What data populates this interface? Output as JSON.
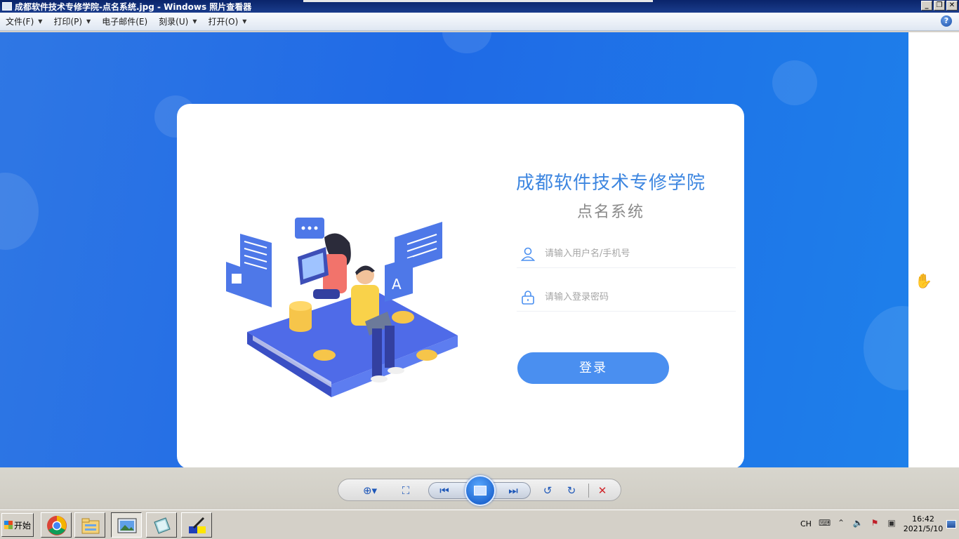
{
  "window": {
    "title": "成都软件技术专修学院-点名系统.jpg - Windows 照片查看器",
    "controls": [
      "_",
      "❐",
      "✕"
    ]
  },
  "menubar": {
    "items": [
      {
        "label": "文件(F)",
        "has_dropdown": true
      },
      {
        "label": "打印(P)",
        "has_dropdown": true
      },
      {
        "label": "电子邮件(E)",
        "has_dropdown": false
      },
      {
        "label": "刻录(U)",
        "has_dropdown": true
      },
      {
        "label": "打开(O)",
        "has_dropdown": true
      }
    ],
    "help": "?"
  },
  "photo": {
    "heading": "成都软件技术专修学院",
    "subheading": "点名系统",
    "username_placeholder": "请输入用户名/手机号",
    "password_placeholder": "请输入登录密码",
    "login_label": "登录",
    "colors": {
      "background": "#1f6ae6",
      "accent": "#4a8ff0",
      "heading": "#3d86e0"
    }
  },
  "viewer_controls": {
    "icons": [
      "zoom-icon",
      "actual-size-icon",
      "previous-icon",
      "slideshow-icon",
      "next-icon",
      "rotate-left-icon",
      "rotate-right-icon",
      "delete-icon"
    ]
  },
  "taskbar": {
    "start_label": "开始",
    "apps": [
      "chrome-icon",
      "file-explorer-icon",
      "photo-viewer-icon",
      "notepad-icon",
      "paint-icon"
    ],
    "language": "CH",
    "clock_time": "16:42",
    "clock_date": "2021/5/10"
  }
}
